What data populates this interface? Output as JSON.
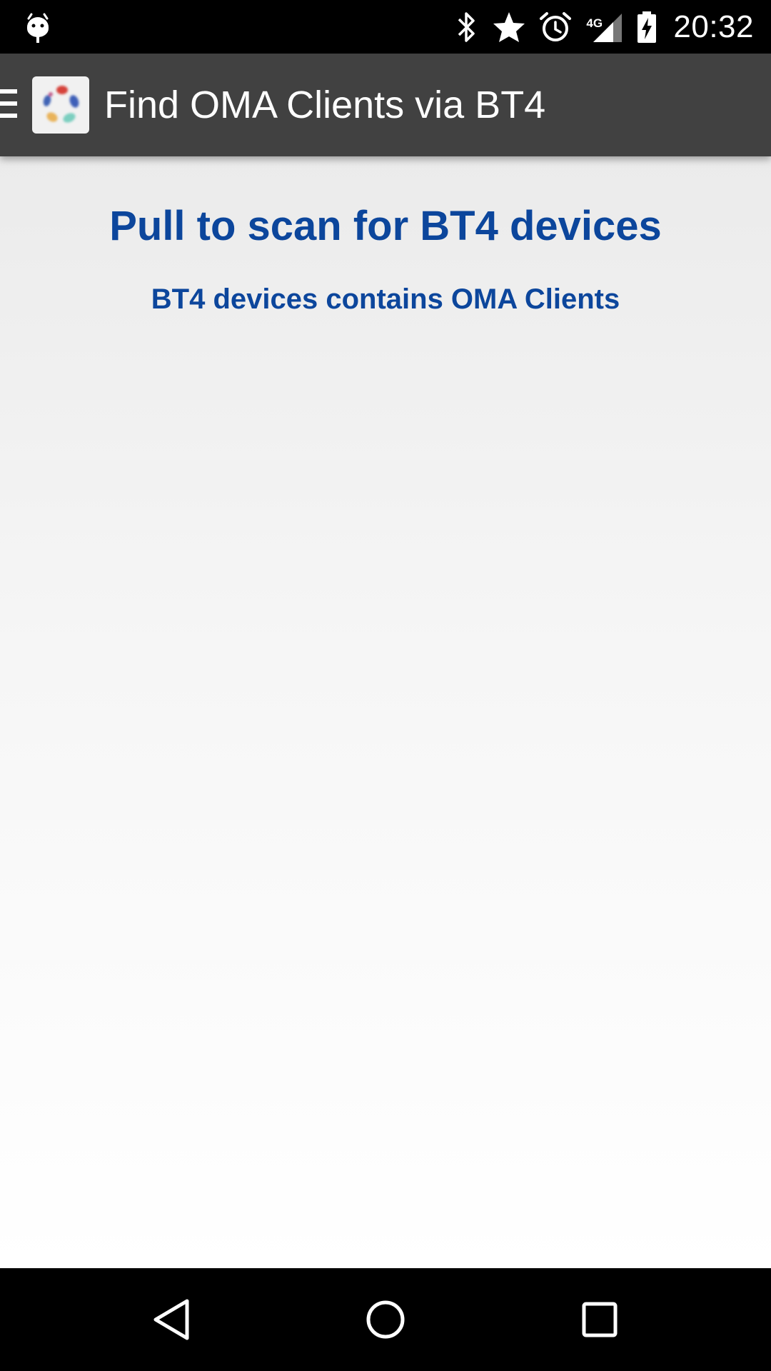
{
  "status_bar": {
    "time": "20:32",
    "network_label": "4G",
    "icons": [
      "android-debug-icon",
      "bluetooth-icon",
      "star-icon",
      "alarm-icon",
      "signal-icon",
      "battery-charging-icon"
    ]
  },
  "app_bar": {
    "title": "Find OMA Clients via BT4",
    "menu_icon": "hamburger-menu-icon",
    "logo_icon": "app-logo-icon"
  },
  "main": {
    "headline": "Pull to scan for BT4 devices",
    "subline": "BT4 devices contains OMA Clients"
  },
  "nav_bar": {
    "buttons": [
      "back-icon",
      "home-icon",
      "recents-icon"
    ]
  },
  "colors": {
    "app_bar": "#414141",
    "accent_text": "#0c469c",
    "content_top": "#ebebeb",
    "content_bottom": "#ffffff"
  }
}
